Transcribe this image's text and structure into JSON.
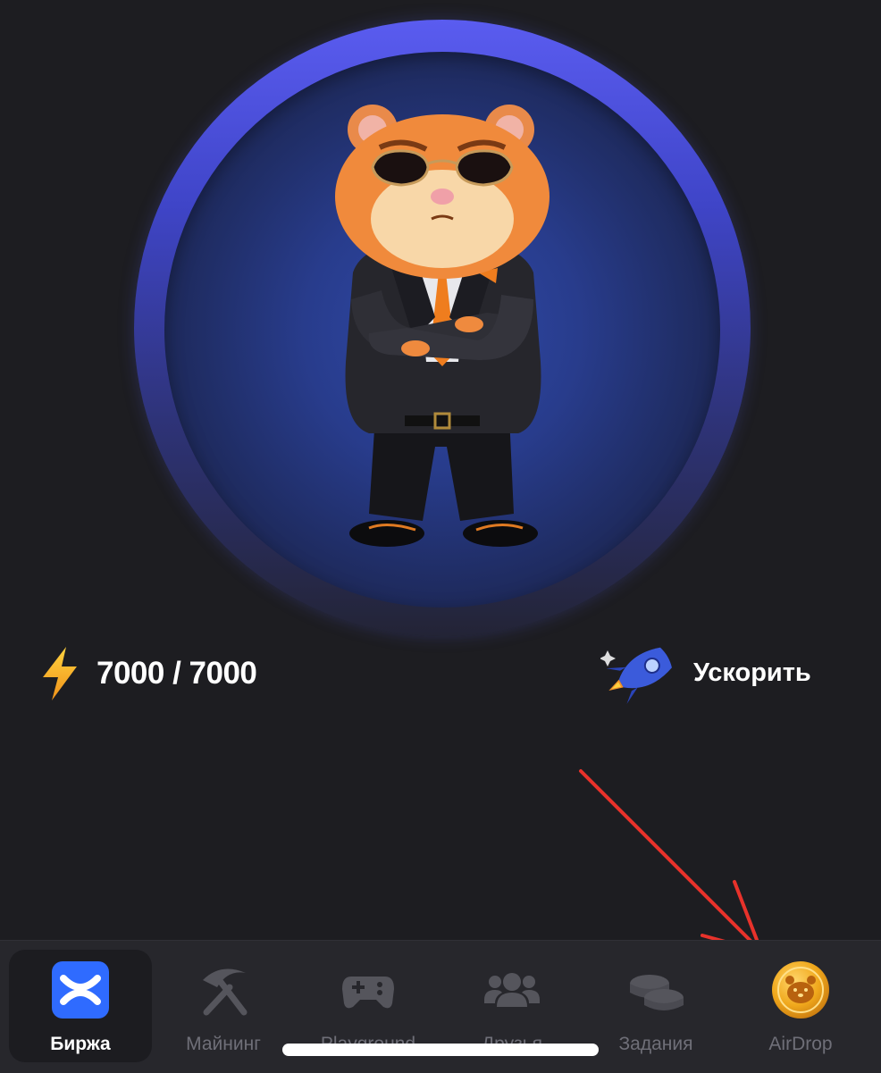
{
  "energy": {
    "current": "7000",
    "max": "7000",
    "text": "7000 / 7000",
    "icon": "lightning-bolt-icon"
  },
  "boost": {
    "label": "Ускорить",
    "icon": "rocket-icon"
  },
  "tap_target": {
    "image": "hamster-in-suit",
    "ring_color": "#5a5cf0"
  },
  "annotation": {
    "type": "red-arrow",
    "color": "#e8322b",
    "points_to": "AirDrop"
  },
  "nav": {
    "active": "Биржа",
    "items": [
      {
        "label": "Биржа",
        "icon": "exchange-x-icon",
        "active": true
      },
      {
        "label": "Майнинг",
        "icon": "pickaxe-icon",
        "active": false
      },
      {
        "label": "Playground",
        "icon": "gamepad-icon",
        "active": false
      },
      {
        "label": "Друзья",
        "icon": "friends-icon",
        "active": false
      },
      {
        "label": "Задания",
        "icon": "coins-icon",
        "active": false
      },
      {
        "label": "AirDrop",
        "icon": "hamster-coin-icon",
        "active": false
      }
    ]
  },
  "colors": {
    "background": "#1d1d21",
    "nav_bg": "#27272c",
    "accent": "#2f6bff",
    "coin": "#f0a81c"
  }
}
